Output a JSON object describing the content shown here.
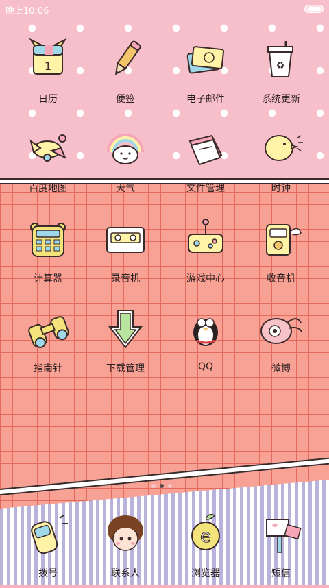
{
  "status_bar": {
    "time": "晚上10:06"
  },
  "apps": [
    {
      "label": "日历",
      "icon": "calendar-icon"
    },
    {
      "label": "便签",
      "icon": "pencil-icon"
    },
    {
      "label": "电子邮件",
      "icon": "mail-icon"
    },
    {
      "label": "系统更新",
      "icon": "update-icon"
    },
    {
      "label": "百度地图",
      "icon": "map-plane-icon"
    },
    {
      "label": "天气",
      "icon": "weather-icon"
    },
    {
      "label": "文件管理",
      "icon": "files-icon"
    },
    {
      "label": "时钟",
      "icon": "chick-icon"
    },
    {
      "label": "计算器",
      "icon": "calculator-icon"
    },
    {
      "label": "录音机",
      "icon": "cassette-icon"
    },
    {
      "label": "游戏中心",
      "icon": "game-icon"
    },
    {
      "label": "收音机",
      "icon": "radio-icon"
    },
    {
      "label": "指南针",
      "icon": "binoculars-icon"
    },
    {
      "label": "下载管理",
      "icon": "download-icon"
    },
    {
      "label": "QQ",
      "icon": "penguin-icon"
    },
    {
      "label": "微博",
      "icon": "weibo-icon"
    }
  ],
  "dock": [
    {
      "label": "拨号",
      "icon": "phone-icon"
    },
    {
      "label": "联系人",
      "icon": "contact-girl-icon"
    },
    {
      "label": "浏览器",
      "icon": "browser-icon"
    },
    {
      "label": "短信",
      "icon": "mailbox-icon"
    }
  ],
  "pager": {
    "pages": 3,
    "current": 2
  }
}
